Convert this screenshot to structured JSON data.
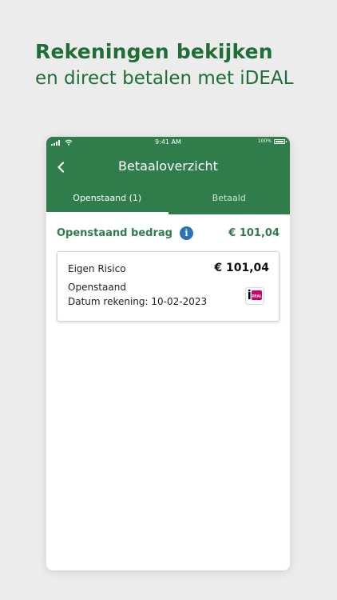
{
  "promo": {
    "headline_line1": "Rekeningen bekijken",
    "headline_line2": "en direct betalen met iDEAL"
  },
  "status_bar": {
    "time": "9:41 AM",
    "battery": "100%"
  },
  "nav": {
    "title": "Betaaloverzicht"
  },
  "tabs": [
    {
      "label": "Openstaand (1)",
      "active": true
    },
    {
      "label": "Betaald",
      "active": false
    }
  ],
  "summary": {
    "label": "Openstaand bedrag",
    "amount": "€ 101,04"
  },
  "invoices": [
    {
      "title": "Eigen Risico",
      "amount": "€ 101,04",
      "status": "Openstaand",
      "date_text": "Datum rekening: 10-02-2023",
      "payment_icon": "ideal-icon"
    }
  ],
  "colors": {
    "brand_green": "#2f7d4a",
    "headline_green": "#1e6e35",
    "info_blue": "#2a73b4",
    "ideal_pink": "#cc0066"
  },
  "icons": {
    "back": "chevron-left-icon",
    "info": "info-icon",
    "payment": "ideal-icon"
  }
}
